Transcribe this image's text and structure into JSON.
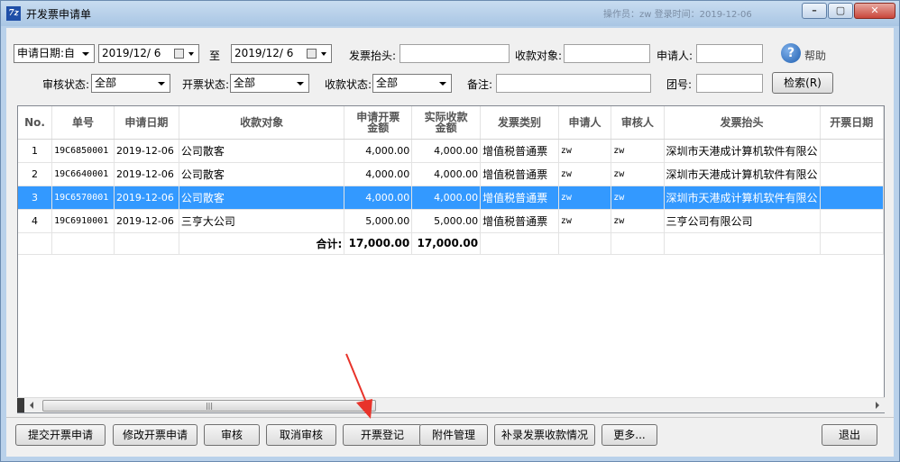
{
  "window": {
    "title": "开发票申请单",
    "title_blurred": "操作员：zw  登录时间：2019-12-06"
  },
  "filters": {
    "date_mode": "申请日期:自",
    "date_from": "2019/12/ 6",
    "to_label": "至",
    "date_to": "2019/12/ 6",
    "invoice_title_label": "发票抬头:",
    "invoice_title_value": "",
    "payee_label": "收款对象:",
    "payee_value": "",
    "applicant_label": "申请人:",
    "applicant_value": "",
    "help_label": "帮助",
    "audit_status_label": "审核状态:",
    "audit_status_value": "全部",
    "invoice_status_label": "开票状态:",
    "invoice_status_value": "全部",
    "collect_status_label": "收款状态:",
    "collect_status_value": "全部",
    "remark_label": "备注:",
    "remark_value": "",
    "group_label": "团号:",
    "group_value": "",
    "search_button": "检索(R)"
  },
  "table": {
    "columns": [
      "No.",
      "单号",
      "申请日期",
      "收款对象",
      "申请开票\n金额",
      "实际收款\n金额",
      "发票类别",
      "申请人",
      "审核人",
      "发票抬头",
      "开票日期"
    ],
    "rows": [
      {
        "no": "1",
        "order": "19C6850001",
        "date": "2019-12-06",
        "payee": "公司散客",
        "apply_amount": "4,000.00",
        "actual_amount": "4,000.00",
        "type": "增值税普通票",
        "applicant": "zw",
        "auditor": "zw",
        "title": "深圳市天港成计算机软件有限公",
        "invoice_date": ""
      },
      {
        "no": "2",
        "order": "19C6640001",
        "date": "2019-12-06",
        "payee": "公司散客",
        "apply_amount": "4,000.00",
        "actual_amount": "4,000.00",
        "type": "增值税普通票",
        "applicant": "zw",
        "auditor": "zw",
        "title": "深圳市天港成计算机软件有限公",
        "invoice_date": ""
      },
      {
        "no": "3",
        "order": "19C6570001",
        "date": "2019-12-06",
        "payee": "公司散客",
        "apply_amount": "4,000.00",
        "actual_amount": "4,000.00",
        "type": "增值税普通票",
        "applicant": "zw",
        "auditor": "zw",
        "title": "深圳市天港成计算机软件有限公",
        "invoice_date": ""
      },
      {
        "no": "4",
        "order": "19C6910001",
        "date": "2019-12-06",
        "payee": "三亨大公司",
        "apply_amount": "5,000.00",
        "actual_amount": "5,000.00",
        "type": "增值税普通票",
        "applicant": "zw",
        "auditor": "zw",
        "title": "三亨公司有限公司",
        "invoice_date": ""
      }
    ],
    "selected_row": 2,
    "total_label": "合计:",
    "total_apply": "17,000.00",
    "total_actual": "17,000.00"
  },
  "buttons": {
    "submit": "提交开票申请",
    "modify": "修改开票申请",
    "audit": "审核",
    "cancel_audit": "取消审核",
    "register": "开票登记",
    "attachments": "附件管理",
    "supplement": "补录发票收款情况",
    "more": "更多...",
    "exit": "退出"
  },
  "colors": {
    "selection": "#3399ff",
    "annotation_arrow": "#e8332a"
  }
}
